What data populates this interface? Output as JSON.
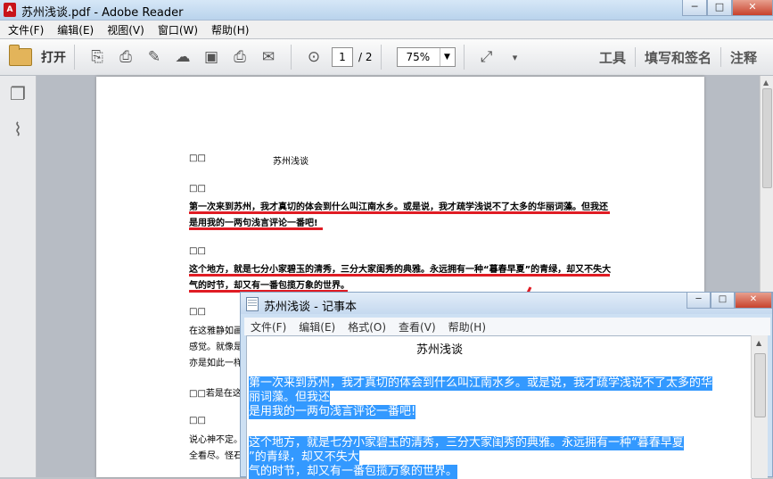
{
  "window": {
    "title": "苏州浅谈.pdf - Adobe Reader",
    "app_icon": "adobe-reader-icon",
    "buttons": {
      "minimize": "─",
      "maximize": "□",
      "close": "✕"
    }
  },
  "menu": [
    "文件(F)",
    "编辑(E)",
    "视图(V)",
    "窗口(W)",
    "帮助(H)"
  ],
  "toolbar": {
    "open_label": "打开",
    "page_current": "1",
    "page_total": "/ 2",
    "zoom": "75%",
    "right_links": [
      "工具",
      "填写和签名",
      "注释"
    ]
  },
  "pdf": {
    "title_prefix": "□□",
    "title": "苏州浅谈",
    "p1_marker": "□□",
    "p1_line1": "第一次来到苏州，我才真切的体会到什么叫江南水乡。或是说，我才疏学浅说不了太多的华丽词藻。但我还",
    "p1_line2": "是用我的一两句浅言评论一番吧!",
    "p2_marker": "□□",
    "p2_line1": "这个地方，就是七分小家碧玉的清秀，三分大家闺秀的典雅。永远拥有一种“暮春早夏”的青绿，却又不失大",
    "p2_line2": "气的时节，却又有一番包揽万象的世界。",
    "p3_marker": "□□",
    "p3_line1": "在这雅静如画",
    "p3_line2": "感觉。就像是",
    "p3_line3": "亦是如此一样",
    "p4_line": "□□若是在这",
    "p5_marker": "□□",
    "p5_line1": "说心神不定。",
    "p5_line2": "全看尽。怪石"
  },
  "notepad": {
    "title": "苏州浅谈 - 记事本",
    "menu": [
      "文件(F)",
      "编辑(E)",
      "格式(O)",
      "查看(V)",
      "帮助(H)"
    ],
    "heading": "苏州浅谈",
    "sel_line1": "第一次来到苏州，我才真切的体会到什么叫江南水乡。或是说，我才疏学浅说不了太多的华",
    "sel_line2": "丽词藻。但我还",
    "sel_line3": "是用我的一两句浅言评论一番吧!",
    "sel_line4": "    这个地方，就是七分小家碧玉的清秀，三分大家闺秀的典雅。永远拥有一种“暮春早夏",
    "sel_line5": "”的青绿，却又不失大",
    "sel_line6": "气的时节，却又有一番包揽万象的世界。"
  },
  "colors": {
    "underline": "#e01c24",
    "selection": "#3399ff",
    "arrow": "#e01c24"
  }
}
